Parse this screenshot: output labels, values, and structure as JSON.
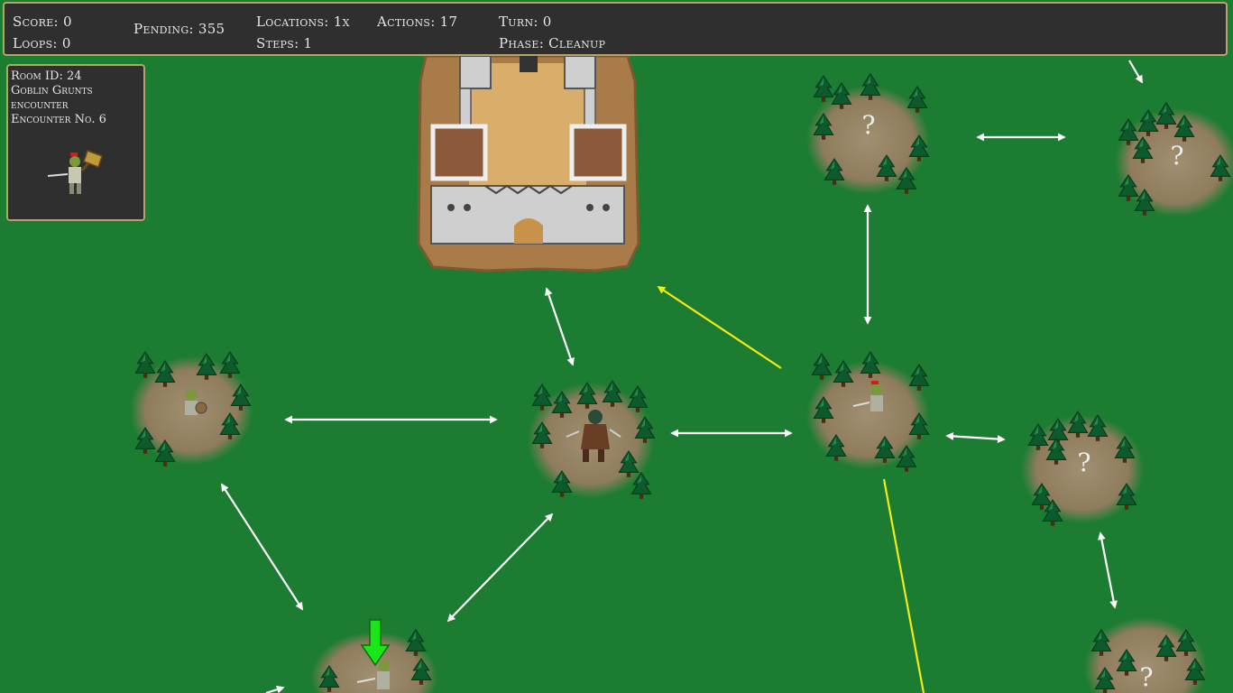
{
  "hud": {
    "score": "Score: 0",
    "loops": "Loops: 0",
    "pending": "Pending: 355",
    "locations": "Locations: 1x",
    "steps": "Steps: 1",
    "actions": "Actions: 17",
    "turn": "Turn: 0",
    "phase": "Phase: Cleanup"
  },
  "room_panel": {
    "room_id": "Room ID: 24",
    "name": "Goblin Grunts",
    "type": "encounter",
    "encounter_no": "Encounter No. 6",
    "icon": "goblin-with-hammer-icon"
  },
  "map": {
    "unknown_marker": "?",
    "colors": {
      "grass": "#1c7d32",
      "path_link": "#ffffff",
      "highlight_link": "#f2ea1a",
      "current_marker": "#19e619",
      "panel_bg": "#2f2f2f",
      "panel_border": "#b4a46a"
    },
    "icons": [
      "castle-icon",
      "forest-clearing-icon",
      "goblin-icon",
      "hero-icon",
      "green-down-arrow-icon"
    ]
  }
}
